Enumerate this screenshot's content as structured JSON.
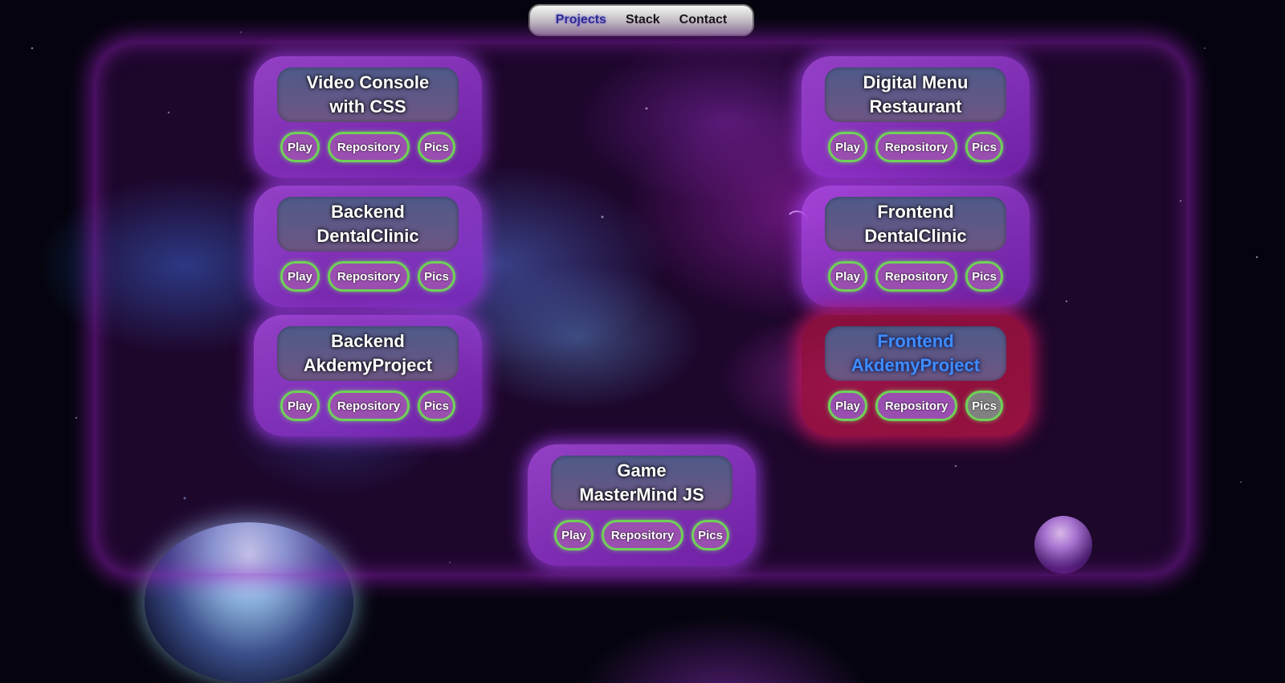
{
  "nav": {
    "items": [
      {
        "label": "Projects",
        "active": true
      },
      {
        "label": "Stack",
        "active": false
      },
      {
        "label": "Contact",
        "active": false
      }
    ]
  },
  "buttons": {
    "play": "Play",
    "repository": "Repository",
    "pics": "Pics"
  },
  "projects": [
    {
      "title": "Video Console\nwith CSS"
    },
    {
      "title": "Digital Menu\nRestaurant"
    },
    {
      "title": "Backend\nDentalClinic"
    },
    {
      "title": "Frontend\nDentalClinic"
    },
    {
      "title": "Backend\nAkdemyProject"
    },
    {
      "title": "Frontend\nAkdemyProject",
      "highlighted": true
    },
    {
      "title": "Game\nMasterMind JS"
    }
  ],
  "colors": {
    "card": "#a84ee0",
    "card_highlight": "#a0143e",
    "button_border": "#6fd257",
    "highlight_title": "#3f8cff"
  }
}
